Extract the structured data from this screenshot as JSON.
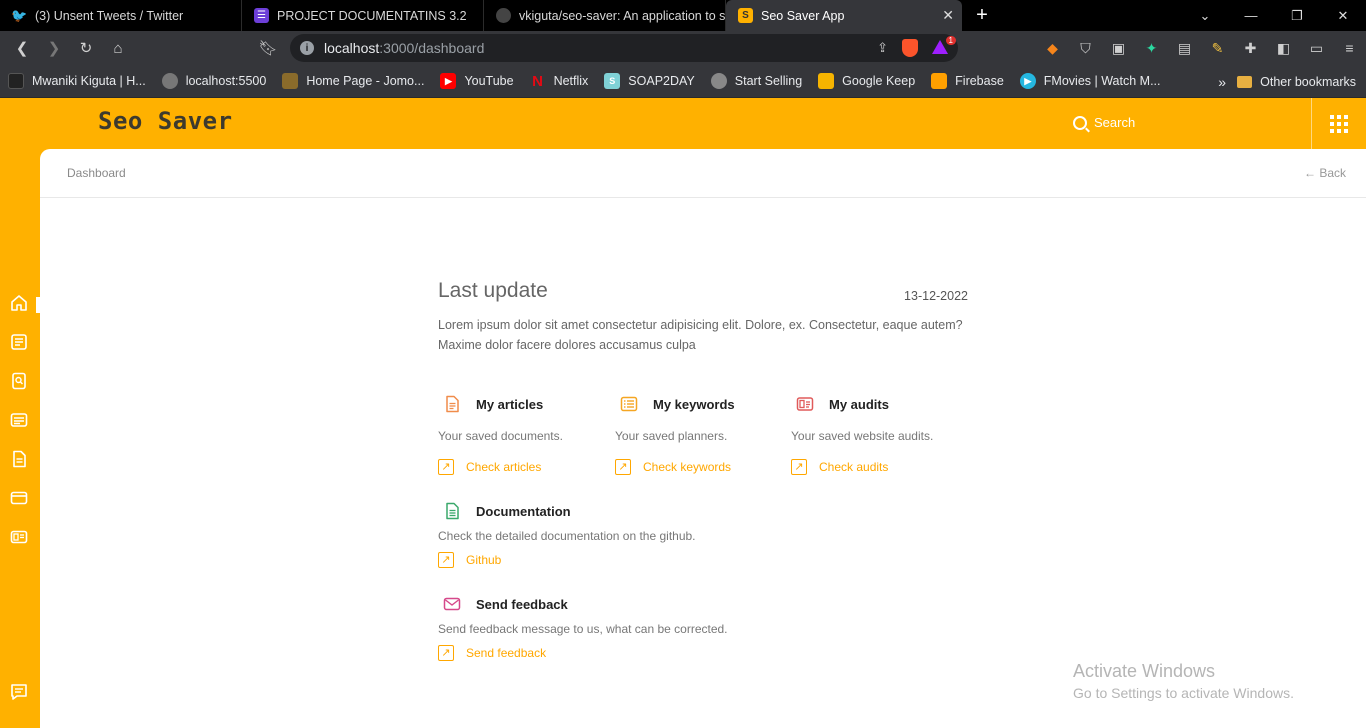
{
  "browser": {
    "tabs": [
      {
        "title": "(3) Unsent Tweets / Twitter",
        "icon": "twitter-icon",
        "color": "#1d9bf0"
      },
      {
        "title": "PROJECT DOCUMENTATINS 3.2",
        "icon": "list-icon",
        "color": "#6d3fd8"
      },
      {
        "title": "vkiguta/seo-saver: An application to store",
        "icon": "github-icon",
        "color": "#444444"
      },
      {
        "title": "Seo Saver App",
        "icon": "seo-saver-icon",
        "color": "#ffb100",
        "active": true
      }
    ],
    "address": {
      "host": "localhost",
      "path": ":3000/dashboard"
    },
    "bookmarks": [
      {
        "label": "Mwaniki Kiguta | H...",
        "color": "#222222"
      },
      {
        "label": "localhost:5500",
        "color": "#777777"
      },
      {
        "label": "Home Page - Jomo...",
        "color": "#8a6b2b"
      },
      {
        "label": "YouTube",
        "color": "#ff0000"
      },
      {
        "label": "Netflix",
        "color": "#e50914"
      },
      {
        "label": "SOAP2DAY",
        "color": "#7fd1d6"
      },
      {
        "label": "Start Selling",
        "color": "#888888"
      },
      {
        "label": "Google Keep",
        "color": "#f6b400"
      },
      {
        "label": "Firebase",
        "color": "#ffa000"
      },
      {
        "label": "FMovies | Watch M...",
        "color": "#25b7e0"
      }
    ],
    "other_bookmarks": "Other bookmarks"
  },
  "app": {
    "brand": "Seo Saver",
    "search_label": "Search",
    "breadcrumb": "Dashboard",
    "back_label": "Back",
    "accent": "#ffb100",
    "link_color": "#ffa700"
  },
  "update": {
    "title": "Last update",
    "date": "13-12-2022",
    "text": "Lorem ipsum dolor sit amet consectetur adipisicing elit. Dolore, ex. Consectetur, eaque autem? Maxime dolor facere dolores accusamus culpa"
  },
  "cards": {
    "articles": {
      "title": "My articles",
      "desc": "Your saved documents.",
      "link": "Check articles",
      "icon": "document-icon"
    },
    "keywords": {
      "title": "My keywords",
      "desc": "Your saved planners.",
      "link": "Check keywords",
      "icon": "list-icon"
    },
    "audits": {
      "title": "My audits",
      "desc": "Your saved website audits.",
      "link": "Check audits",
      "icon": "audit-icon"
    },
    "documentation": {
      "title": "Documentation",
      "desc": "Check the detailed documentation on the github.",
      "link": "Github",
      "icon": "file-icon"
    },
    "feedback": {
      "title": "Send feedback",
      "desc": "Send feedback message to us, what can be corrected.",
      "link": "Send feedback",
      "icon": "mail-icon"
    }
  },
  "watermark": {
    "line1": "Activate Windows",
    "line2": "Go to Settings to activate Windows."
  }
}
